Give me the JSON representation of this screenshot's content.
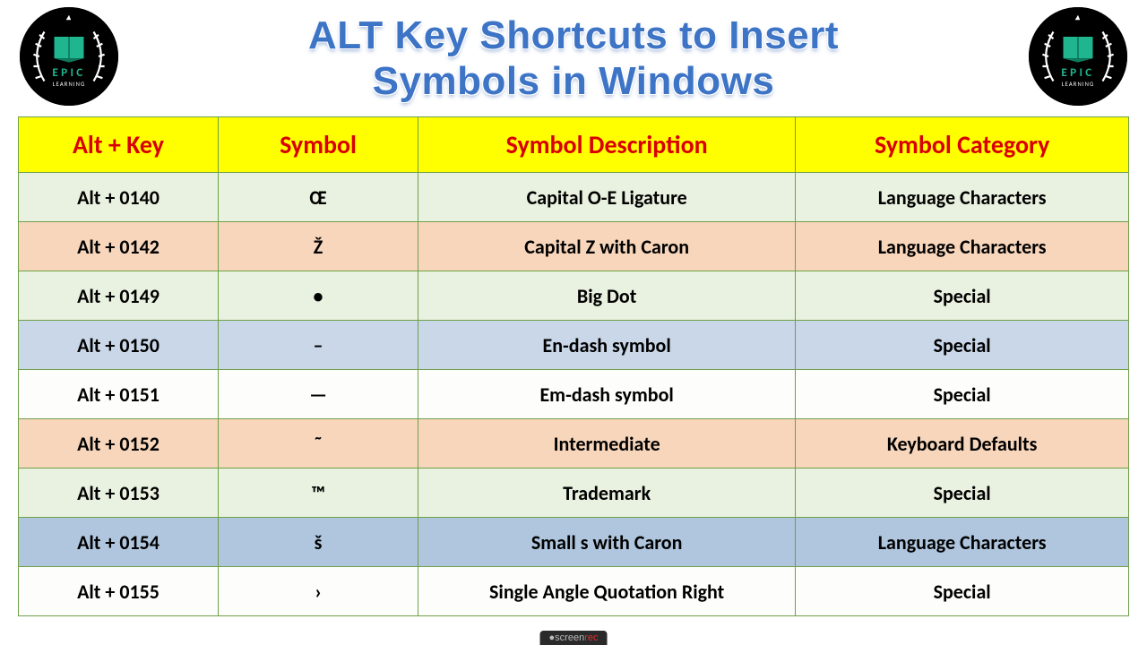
{
  "title_line1": "ALT Key Shortcuts to Insert",
  "title_line2": "Symbols in Windows",
  "headers": {
    "col1": "Alt + Key",
    "col2": "Symbol",
    "col3": "Symbol Description",
    "col4": "Symbol Category"
  },
  "rows": [
    {
      "alt": "Alt + 0140",
      "sym": "Œ",
      "desc": "Capital O-E Ligature",
      "cat": "Language Characters",
      "cls": "row-green"
    },
    {
      "alt": "Alt + 0142",
      "sym": "Ž",
      "desc": "Capital Z with Caron",
      "cat": "Language Characters",
      "cls": "row-orange"
    },
    {
      "alt": "Alt + 0149",
      "sym": "•",
      "desc": "Big Dot",
      "cat": "Special",
      "cls": "row-green"
    },
    {
      "alt": "Alt + 0150",
      "sym": "–",
      "desc": "En-dash symbol",
      "cat": "Special",
      "cls": "row-blue"
    },
    {
      "alt": "Alt + 0151",
      "sym": "—",
      "desc": "Em-dash symbol",
      "cat": "Special",
      "cls": "row-white"
    },
    {
      "alt": "Alt + 0152",
      "sym": "˜",
      "desc": "Intermediate",
      "cat": "Keyboard Defaults",
      "cls": "row-orange"
    },
    {
      "alt": "Alt + 0153",
      "sym": "™",
      "desc": "Trademark",
      "cat": "Special",
      "cls": "row-green"
    },
    {
      "alt": "Alt + 0154",
      "sym": "š",
      "desc": "Small s with Caron",
      "cat": "Language Characters",
      "cls": "row-lightblue"
    },
    {
      "alt": "Alt + 0155",
      "sym": "›",
      "desc": "Single Angle Quotation Right",
      "cat": "Special",
      "cls": "row-white"
    }
  ],
  "watermark": {
    "pre": "●screen",
    "rec": "rec"
  },
  "logo": {
    "text_top": "E P I C",
    "text_bottom": "LEARNING"
  },
  "chart_data": {
    "type": "table",
    "title": "ALT Key Shortcuts to Insert Symbols in Windows",
    "columns": [
      "Alt + Key",
      "Symbol",
      "Symbol Description",
      "Symbol Category"
    ],
    "rows": [
      [
        "Alt + 0140",
        "Œ",
        "Capital O-E Ligature",
        "Language Characters"
      ],
      [
        "Alt + 0142",
        "Ž",
        "Capital Z with Caron",
        "Language Characters"
      ],
      [
        "Alt + 0149",
        "•",
        "Big Dot",
        "Special"
      ],
      [
        "Alt + 0150",
        "–",
        "En-dash symbol",
        "Special"
      ],
      [
        "Alt + 0151",
        "—",
        "Em-dash symbol",
        "Special"
      ],
      [
        "Alt + 0152",
        "˜",
        "Intermediate",
        "Keyboard Defaults"
      ],
      [
        "Alt + 0153",
        "™",
        "Trademark",
        "Special"
      ],
      [
        "Alt + 0154",
        "š",
        "Small s with Caron",
        "Language Characters"
      ],
      [
        "Alt + 0155",
        "›",
        "Single Angle Quotation Right",
        "Special"
      ]
    ]
  }
}
